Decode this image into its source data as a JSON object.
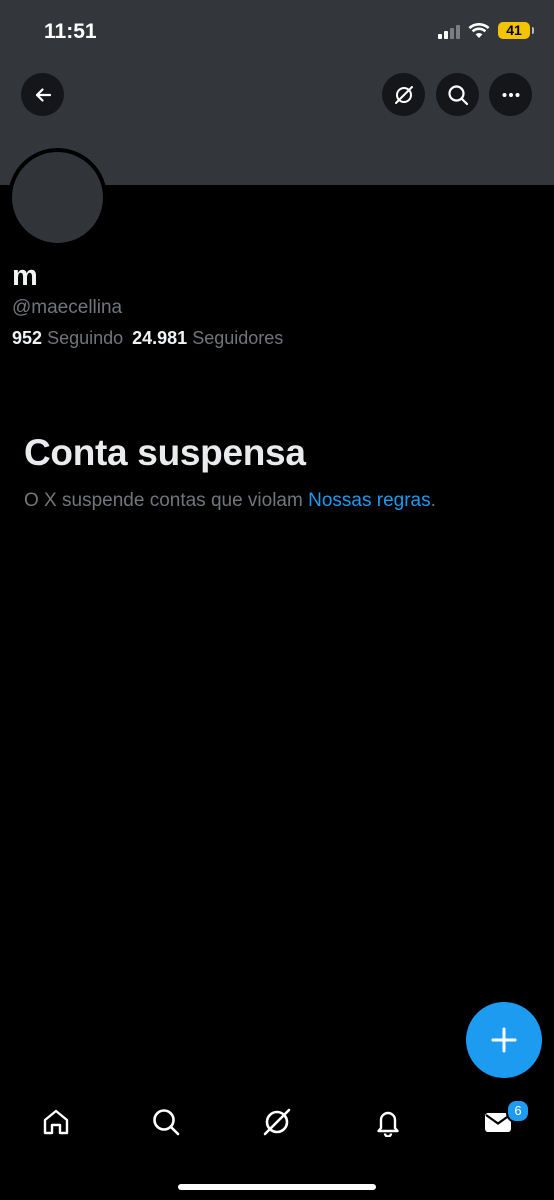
{
  "status_bar": {
    "time": "11:51",
    "battery": "41"
  },
  "header": {
    "back_icon": "arrow-left-icon",
    "grok_icon": "grok-icon",
    "search_icon": "search-icon",
    "more_icon": "more-icon"
  },
  "profile": {
    "name": "m",
    "handle": "@maecellina",
    "following_count": "952",
    "following_label": "Seguindo",
    "followers_count": "24.981",
    "followers_label": "Seguidores"
  },
  "suspended": {
    "title": "Conta suspensa",
    "message": "O X suspende contas que violam ",
    "link": "Nossas regras",
    "suffix": "."
  },
  "compose_icon": "plus-icon",
  "bottom_nav": {
    "items": [
      "home-icon",
      "search-icon",
      "grok-icon",
      "notifications-icon",
      "messages-icon"
    ],
    "messages_badge": "6"
  },
  "colors": {
    "accent": "#1d9bf0",
    "banner": "#33373b",
    "background": "#000000"
  }
}
